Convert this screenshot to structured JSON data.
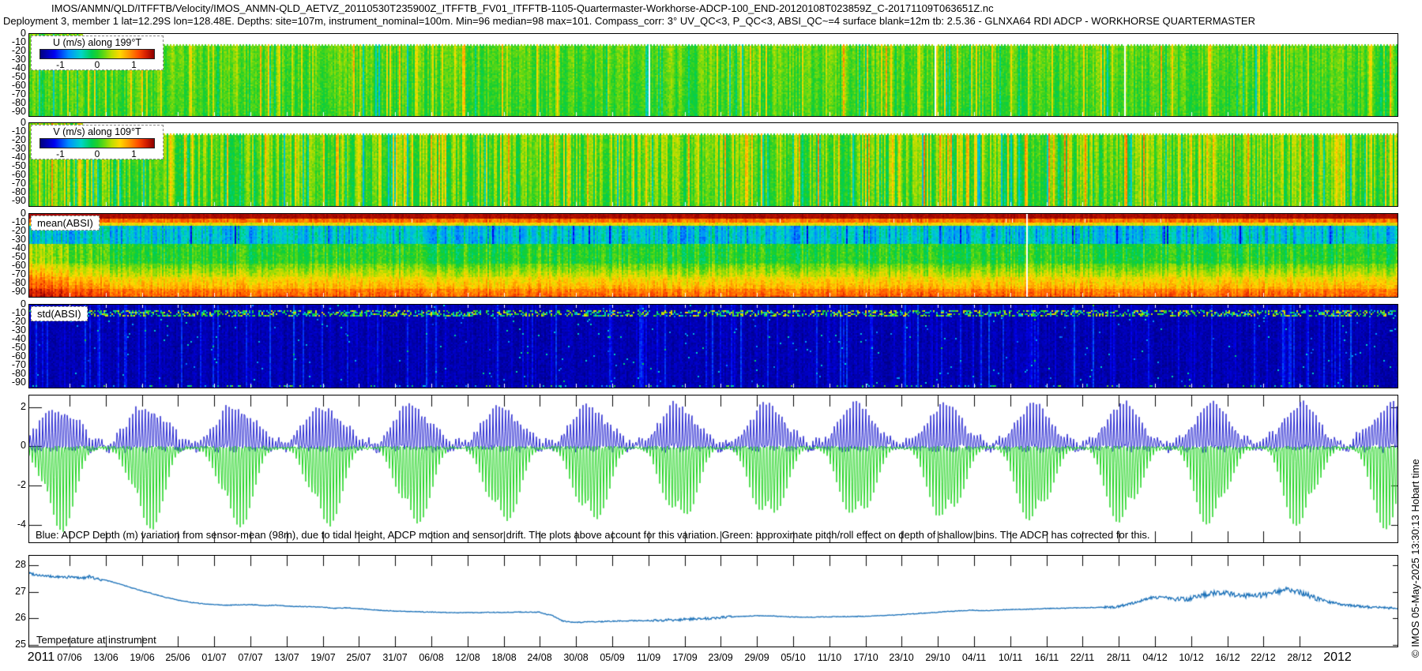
{
  "header": {
    "title_line1": "IMOS/ANMN/QLD/ITFFTB/Velocity/IMOS_ANMN-QLD_AETVZ_20110530T235900Z_ITFFTB_FV01_ITFFTB-1105-Quartermaster-Workhorse-ADCP-100_END-20120108T023859Z_C-20171109T063651Z.nc",
    "title_line2": "Deployment 3, member 1 lat=12.29S lon=128.48E. Depths: site=107m, instrument_nominal=100m. Min=96 median=98 max=101. Compass_corr: 3° UV_QC<3, P_QC<3, ABSI_QC~=4 surface blank=12m tb: 2.5.36 - GLNXA64 RDI ADCP - WORKHORSE QUARTERMASTER"
  },
  "footer": {
    "copyright_vertical": "© IMOS 05-May-2025 13:30:13 Hobart time"
  },
  "colorbar": {
    "ticks": [
      "-1",
      "0",
      "1"
    ]
  },
  "depth_axis": {
    "ticks": [
      "0",
      "-10",
      "-20",
      "-30",
      "-40",
      "-50",
      "-60",
      "-70",
      "-80",
      "-90"
    ],
    "range": [
      0,
      -95
    ]
  },
  "x_axis": {
    "year_start": "2011",
    "year_end": "2012",
    "tick_labels": [
      "07/06",
      "13/06",
      "19/06",
      "25/06",
      "01/07",
      "07/07",
      "13/07",
      "19/07",
      "25/07",
      "31/07",
      "06/08",
      "12/08",
      "18/08",
      "24/08",
      "30/08",
      "05/09",
      "11/09",
      "17/09",
      "23/09",
      "29/09",
      "05/10",
      "11/10",
      "17/10",
      "23/10",
      "29/10",
      "04/11",
      "10/11",
      "16/11",
      "22/11",
      "28/11",
      "04/12",
      "10/12",
      "16/12",
      "22/12",
      "28/12"
    ]
  },
  "panels": {
    "u": {
      "legend_title": "U (m/s) along 199°T"
    },
    "v": {
      "legend_title": "V (m/s) along 109°T"
    },
    "mean_absi": {
      "label": "mean(ABSI)"
    },
    "std_absi": {
      "label": "std(ABSI)"
    },
    "depth": {
      "y_ticks": [
        "2",
        "0",
        "-2",
        "-4"
      ],
      "caption": "Blue: ADCP Depth (m) variation from sensor-mean (98m), due to tidal height, ADCP motion and sensor drift. The plots above account for this variation. Green: approximate pitch/roll effect on depth of shallow bins. The ADCP has corrected for this."
    },
    "temperature": {
      "label": "Temperature at instrument",
      "y_ticks": [
        "28",
        "27",
        "26",
        "25"
      ]
    }
  },
  "colormap_stops": [
    [
      0.0,
      0,
      0,
      128
    ],
    [
      0.125,
      0,
      0,
      240
    ],
    [
      0.25,
      0,
      144,
      255
    ],
    [
      0.36,
      0,
      213,
      200
    ],
    [
      0.45,
      0,
      206,
      83
    ],
    [
      0.5,
      30,
      208,
      44
    ],
    [
      0.56,
      99,
      216,
      19
    ],
    [
      0.625,
      188,
      222,
      0
    ],
    [
      0.7,
      255,
      216,
      0
    ],
    [
      0.78,
      255,
      151,
      0
    ],
    [
      0.86,
      255,
      78,
      0
    ],
    [
      0.93,
      212,
      29,
      0
    ],
    [
      1.0,
      140,
      0,
      0
    ]
  ],
  "chart_data": [
    {
      "id": "u",
      "type": "heatmap",
      "title": "U (m/s) along 199°T",
      "colorbar": {
        "min": -1,
        "max": 1,
        "ticks": [
          -1,
          0,
          1
        ]
      },
      "y_axis": {
        "ticks": [
          0,
          -10,
          -20,
          -30,
          -40,
          -50,
          -60,
          -70,
          -80,
          -90
        ],
        "range": [
          0,
          -95
        ]
      },
      "x_range": [
        "30/05/2011",
        "08/01/2012"
      ],
      "summary": "Velocity component along 199degT; mostly near 0 to +0.2 m/s (green) with semidiurnal vertical striping, occasional cyan (-0.3) and yellow (+0.4) bursts; surface blanked to ~12 m except first days",
      "render": {
        "seed": 11,
        "base_t": 0.52,
        "col_amp": 0.055,
        "cell_amp": 0.035,
        "teal_prob": 0.07,
        "warm_prob": 0.1,
        "top_blank_frac": 0.125,
        "top_blank_from_x": 68
      }
    },
    {
      "id": "v",
      "type": "heatmap",
      "title": "V (m/s) along 109°T",
      "colorbar": {
        "min": -1,
        "max": 1,
        "ticks": [
          -1,
          0,
          1
        ]
      },
      "y_axis": {
        "ticks": [
          0,
          -10,
          -20,
          -30,
          -40,
          -50,
          -60,
          -70,
          -80,
          -90
        ],
        "range": [
          0,
          -95
        ]
      },
      "x_range": [
        "30/05/2011",
        "08/01/2012"
      ],
      "summary": "Velocity component along 109degT; stronger tidal striping than U, alternating green / yellow (+0.4) / cyan (-0.4) columns",
      "render": {
        "seed": 22,
        "base_t": 0.53,
        "col_amp": 0.09,
        "cell_amp": 0.035,
        "teal_prob": 0.12,
        "warm_prob": 0.16,
        "top_blank_frac": 0.125,
        "top_blank_from_x": 68
      }
    },
    {
      "id": "mean_absi",
      "type": "heatmap",
      "title": "mean(ABSI)",
      "y_axis": {
        "ticks": [
          0,
          -10,
          -20,
          -30,
          -40,
          -50,
          -60,
          -70,
          -80,
          -90
        ],
        "range": [
          0,
          -95
        ]
      },
      "depth_bands": [
        {
          "depth": "0 to -5 m",
          "color": "dark red (very high backscatter)"
        },
        {
          "depth": "-5 to -10 m",
          "color": "orange-red"
        },
        {
          "depth": "-10 to -13 m",
          "color": "yellow"
        },
        {
          "depth": "-13 to -35 m",
          "color": "cyan / light blue minimum with green stripes"
        },
        {
          "depth": "-35 to -60 m",
          "color": "green"
        },
        {
          "depth": "-60 to -75 m",
          "color": "yellow-green to yellow"
        },
        {
          "depth": "-75 to -90 m",
          "color": "orange to red, strongest at start of record"
        }
      ],
      "render": {
        "seed": 33,
        "left_hot": true,
        "bands": [
          {
            "y0": 0.0,
            "y1": 0.055,
            "t": 0.97,
            "col": 0.015,
            "cell": 0.015
          },
          {
            "y0": 0.055,
            "y1": 0.1,
            "t": 0.82,
            "col": 0.05,
            "cell": 0.04
          },
          {
            "y0": 0.1,
            "y1": 0.14,
            "t": 0.68,
            "col": 0.05,
            "cell": 0.04
          },
          {
            "y0": 0.14,
            "y1": 0.36,
            "t": 0.33,
            "col": 0.1,
            "cell": 0.04
          },
          {
            "y0": 0.36,
            "y1": 0.6,
            "t": 0.5,
            "col": 0.07,
            "cell": 0.04
          },
          {
            "y0": 0.6,
            "y1": 0.76,
            "t": 0.55,
            "t_end": 0.66,
            "col": 0.06,
            "cell": 0.04
          },
          {
            "y0": 0.76,
            "y1": 0.9,
            "t": 0.68,
            "t_end": 0.76,
            "col": 0.05,
            "cell": 0.04
          },
          {
            "y0": 0.9,
            "y1": 1.0,
            "t": 0.8,
            "t_end": 0.85,
            "col": 0.05,
            "cell": 0.04
          }
        ]
      }
    },
    {
      "id": "std_absi",
      "type": "heatmap",
      "title": "std(ABSI)",
      "y_axis": {
        "ticks": [
          0,
          -10,
          -20,
          -30,
          -40,
          -50,
          -60,
          -70,
          -80,
          -90
        ],
        "range": [
          0,
          -95
        ]
      },
      "summary": "Uniformly low std (dark navy) through the water column; speckled cyan-green-yellow band near -8 to -13 m; sparse lighter-blue vertical streaks; scattered speckles along the bottom bin",
      "render": {
        "seed": 44,
        "base_t": 0.055,
        "col_amp": 0.02,
        "cell_amp": 0.03,
        "streak_prob": 0.16,
        "speckle_band": [
          0.07,
          0.14
        ],
        "speckle_prob": 0.45
      }
    },
    {
      "id": "depth_variation",
      "type": "line",
      "y_axis": {
        "ticks": [
          2,
          0,
          -2,
          -4
        ],
        "range": [
          2.6,
          -4.9
        ]
      },
      "series": [
        {
          "name": "adcp-depth-variation",
          "color": "#2323cf",
          "meaning": "ADCP Depth (m) variation from sensor-mean (98m) due to tidal height, ADCP motion, sensor drift",
          "oscillation_period_days": 0.5175,
          "spring_neap_period_days": 14.77,
          "envelope_range": [
            -0.3,
            2.4
          ]
        },
        {
          "name": "pitch-roll-effect",
          "color": "#1fd31f",
          "meaning": "approximate pitch/roll effect on depth of shallow bins",
          "envelope_range": [
            -4.6,
            0
          ]
        }
      ]
    },
    {
      "id": "temperature",
      "type": "line",
      "title": "Temperature at instrument",
      "color": "#1a70b8",
      "y_axis": {
        "ticks": [
          28,
          27,
          26,
          25
        ],
        "range": [
          28.35,
          24.95
        ]
      },
      "axis": {
        "day0": 1,
        "days": 228
      },
      "points_day_degC": [
        [
          0,
          27.75
        ],
        [
          2,
          27.65
        ],
        [
          4,
          27.58
        ],
        [
          6,
          27.55
        ],
        [
          8,
          27.55
        ],
        [
          10,
          27.52
        ],
        [
          11,
          27.57
        ],
        [
          12,
          27.5
        ],
        [
          14,
          27.42
        ],
        [
          16,
          27.3
        ],
        [
          18,
          27.15
        ],
        [
          20,
          27.02
        ],
        [
          22,
          26.9
        ],
        [
          24,
          26.78
        ],
        [
          26,
          26.68
        ],
        [
          28,
          26.6
        ],
        [
          30,
          26.55
        ],
        [
          32,
          26.52
        ],
        [
          34,
          26.5
        ],
        [
          36,
          26.51
        ],
        [
          38,
          26.52
        ],
        [
          40,
          26.48
        ],
        [
          42,
          26.5
        ],
        [
          44,
          26.46
        ],
        [
          46,
          26.45
        ],
        [
          48,
          26.44
        ],
        [
          50,
          26.42
        ],
        [
          52,
          26.38
        ],
        [
          54,
          26.4
        ],
        [
          56,
          26.37
        ],
        [
          58,
          26.33
        ],
        [
          60,
          26.3
        ],
        [
          62,
          26.28
        ],
        [
          64,
          26.26
        ],
        [
          66,
          26.25
        ],
        [
          68,
          26.24
        ],
        [
          70,
          26.23
        ],
        [
          72,
          26.22
        ],
        [
          74,
          26.22
        ],
        [
          76,
          26.22
        ],
        [
          78,
          26.23
        ],
        [
          80,
          26.23
        ],
        [
          82,
          26.24
        ],
        [
          84,
          26.24
        ],
        [
          86,
          26.23
        ],
        [
          88,
          26.12
        ],
        [
          90,
          25.9
        ],
        [
          92,
          25.85
        ],
        [
          94,
          25.87
        ],
        [
          96,
          25.88
        ],
        [
          98,
          25.9
        ],
        [
          100,
          25.91
        ],
        [
          102,
          25.92
        ],
        [
          104,
          25.92
        ],
        [
          106,
          25.93
        ],
        [
          108,
          25.95
        ],
        [
          110,
          25.96
        ],
        [
          112,
          25.98
        ],
        [
          114,
          26.0
        ],
        [
          116,
          26.04
        ],
        [
          118,
          26.06
        ],
        [
          120,
          26.08
        ],
        [
          122,
          26.1
        ],
        [
          124,
          26.1
        ],
        [
          126,
          26.08
        ],
        [
          128,
          26.06
        ],
        [
          130,
          26.05
        ],
        [
          132,
          26.05
        ],
        [
          134,
          26.06
        ],
        [
          136,
          26.07
        ],
        [
          138,
          26.07
        ],
        [
          140,
          26.08
        ],
        [
          142,
          26.1
        ],
        [
          144,
          26.12
        ],
        [
          146,
          26.14
        ],
        [
          148,
          26.17
        ],
        [
          150,
          26.2
        ],
        [
          152,
          26.23
        ],
        [
          154,
          26.26
        ],
        [
          156,
          26.29
        ],
        [
          158,
          26.31
        ],
        [
          160,
          26.29
        ],
        [
          162,
          26.31
        ],
        [
          164,
          26.33
        ],
        [
          166,
          26.34
        ],
        [
          168,
          26.35
        ],
        [
          170,
          26.37
        ],
        [
          172,
          26.38
        ],
        [
          174,
          26.39
        ],
        [
          176,
          26.4
        ],
        [
          178,
          26.41
        ],
        [
          180,
          26.42
        ],
        [
          182,
          26.43
        ],
        [
          184,
          26.52
        ],
        [
          186,
          26.65
        ],
        [
          188,
          26.78
        ],
        [
          190,
          26.8
        ],
        [
          192,
          26.73
        ],
        [
          194,
          26.7
        ],
        [
          196,
          26.85
        ],
        [
          198,
          26.95
        ],
        [
          200,
          26.98
        ],
        [
          202,
          26.9
        ],
        [
          204,
          26.84
        ],
        [
          206,
          26.86
        ],
        [
          208,
          26.95
        ],
        [
          210,
          27.05
        ],
        [
          211,
          27.1
        ],
        [
          213,
          26.95
        ],
        [
          215,
          26.8
        ],
        [
          217,
          26.65
        ],
        [
          219,
          26.55
        ],
        [
          221,
          26.5
        ],
        [
          223,
          26.45
        ],
        [
          226,
          26.4
        ],
        [
          228,
          26.38
        ]
      ],
      "noise_zones": [
        [
          0,
          13,
          0.05
        ],
        [
          13,
          86,
          0.013
        ],
        [
          86,
          104,
          0.02
        ],
        [
          104,
          118,
          0.05
        ],
        [
          118,
          180,
          0.013
        ],
        [
          180,
          192,
          0.05
        ],
        [
          192,
          216,
          0.1
        ],
        [
          216,
          228,
          0.05
        ]
      ]
    }
  ]
}
